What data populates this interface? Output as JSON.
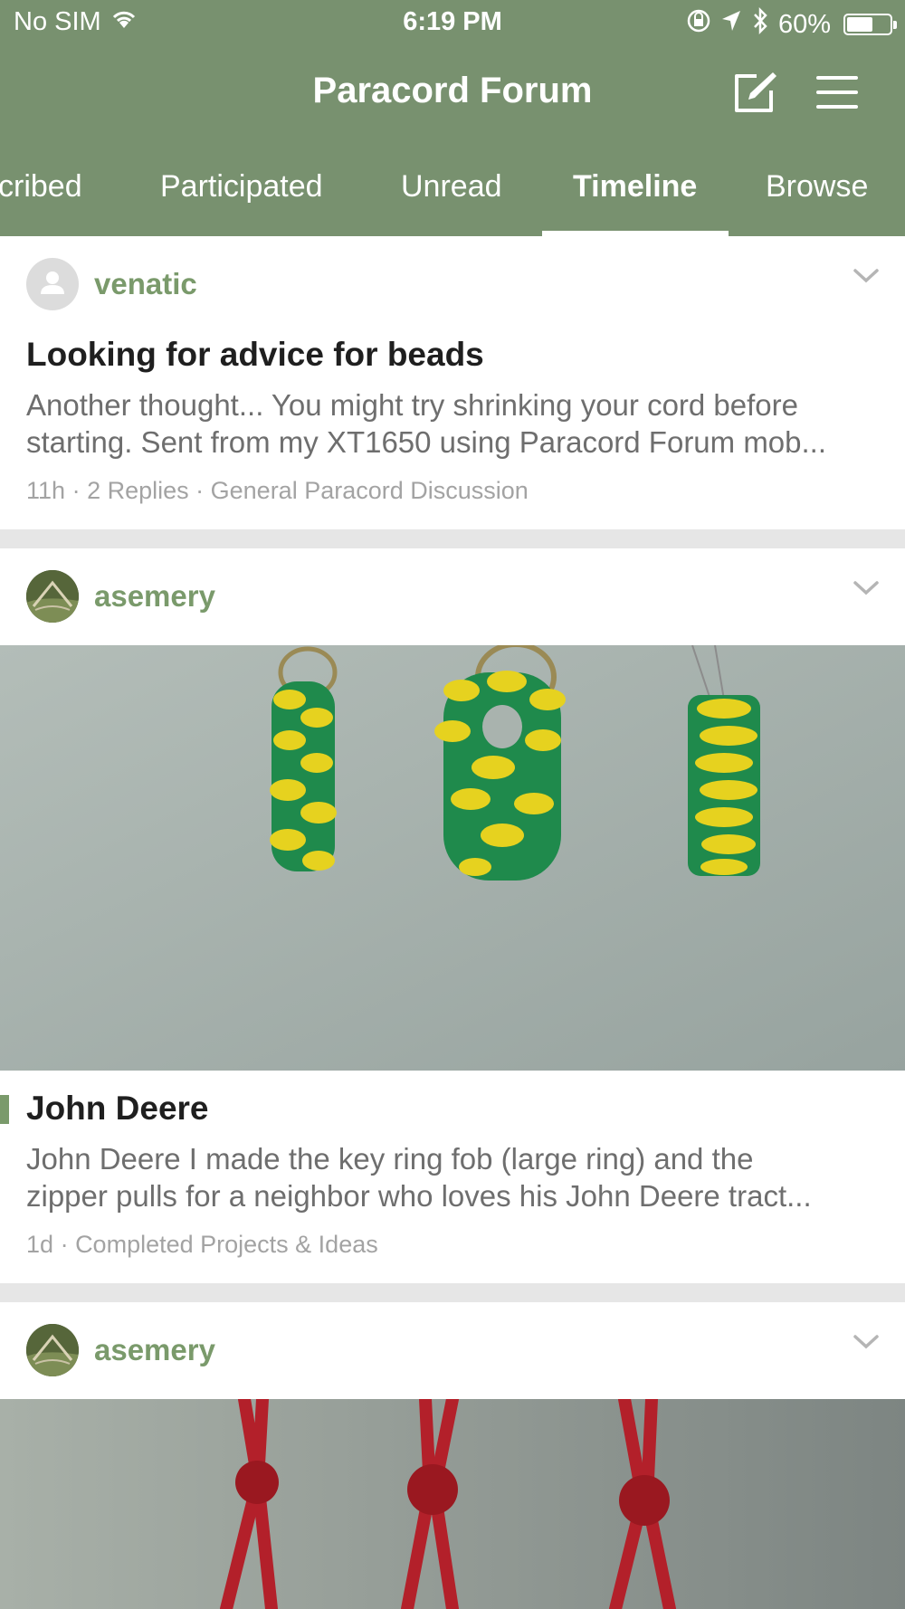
{
  "status_bar": {
    "carrier": "No SIM",
    "time": "6:19 PM",
    "battery_percent": "60%",
    "battery_level": 0.6
  },
  "header": {
    "title": "Paracord Forum",
    "compose_icon": "compose-icon",
    "menu_icon": "hamburger-menu-icon"
  },
  "tabs": [
    {
      "label": "cribed",
      "active": false
    },
    {
      "label": "Participated",
      "active": false
    },
    {
      "label": "Unread",
      "active": false
    },
    {
      "label": "Timeline",
      "active": true
    },
    {
      "label": "Browse",
      "active": false
    }
  ],
  "posts": [
    {
      "author": "venatic",
      "title": "Looking for advice for beads",
      "excerpt_line1": "Another thought... You might try shrinking your cord before",
      "excerpt_line2": "starting. Sent from my XT1650 using Paracord Forum mob...",
      "age": "11h",
      "replies": "2 Replies",
      "forum": "General Paracord Discussion"
    },
    {
      "author": "asemery",
      "title": "John Deere",
      "excerpt_line1": "John Deere I made the key ring fob (large ring) and the",
      "excerpt_line2": "zipper pulls for a neighbor who loves his John Deere tract...",
      "age": "1d",
      "forum": "Completed Projects & Ideas"
    },
    {
      "author": "asemery"
    }
  ],
  "colors": {
    "header_green": "#78916f",
    "username_green": "#7a9a6b",
    "title_text": "#1f1f1f",
    "excerpt_text": "#6e6e6e",
    "meta_text": "#a3a3a3",
    "divider": "#e6e6e6"
  }
}
